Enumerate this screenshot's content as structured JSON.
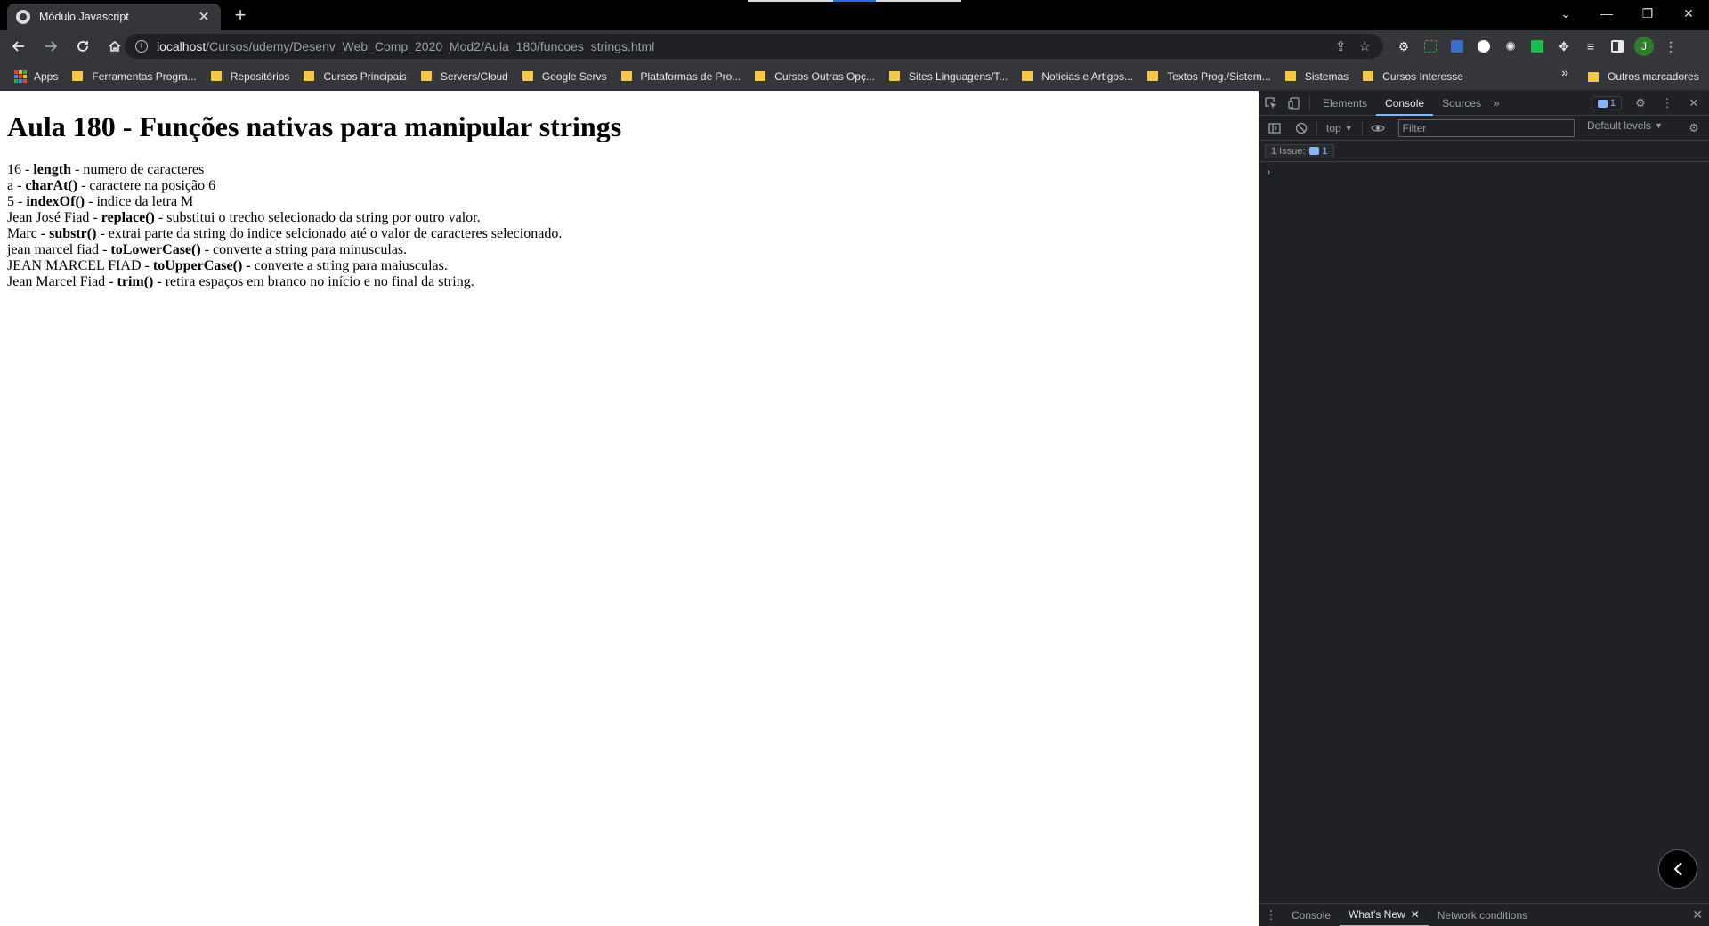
{
  "tab": {
    "title": "Módulo Javascript",
    "close": "✕",
    "new": "+"
  },
  "window_controls": {
    "dropdown": "⌄",
    "minimize": "—",
    "restore": "❐",
    "close": "✕"
  },
  "omnibox": {
    "host": "localhost",
    "path": "/Cursos/udemy/Desenv_Web_Comp_2020_Mod2/Aula_180/funcoes_strings.html"
  },
  "profile": {
    "initial": "J"
  },
  "bookmarks": {
    "apps": "Apps",
    "items": [
      "Ferramentas Progra...",
      "Repositórios",
      "Cursos Principais",
      "Servers/Cloud",
      "Google Servs",
      "Plataformas de Pro...",
      "Cursos Outras Opç...",
      "Sites Linguagens/T...",
      "Noticias e Artigos...",
      "Textos Prog./Sistem...",
      "Sistemas",
      "Cursos Interesse"
    ],
    "more": "»",
    "other": "Outros marcadores"
  },
  "page": {
    "heading": "Aula 180 - Funções nativas para manipular strings",
    "lines": [
      {
        "value": "16",
        "method": "length",
        "desc": "numero de caracteres"
      },
      {
        "value": "a",
        "method": "charAt()",
        "desc": "caractere na posição 6"
      },
      {
        "value": "5",
        "method": "indexOf()",
        "desc": "indice da letra M"
      },
      {
        "value": "Jean José Fiad",
        "method": "replace()",
        "desc": "substitui o trecho selecionado da string por outro valor."
      },
      {
        "value": "Marc",
        "method": "substr()",
        "desc": "extrai parte da string do indice selcionado até o valor de caracteres selecionado."
      },
      {
        "value": "jean marcel fiad",
        "method": "toLowerCase()",
        "desc": "converte a string para minusculas."
      },
      {
        "value": "JEAN MARCEL FIAD",
        "method": "toUpperCase()",
        "desc": "converte a string para maiusculas."
      },
      {
        "value": "Jean Marcel Fiad",
        "method": "trim()",
        "desc": "retira espaços em branco no início e no final da string."
      }
    ]
  },
  "devtools": {
    "tabs": [
      "Elements",
      "Console",
      "Sources"
    ],
    "active_tab": "Console",
    "more_tabs": "»",
    "issues_count": "1",
    "context": "top",
    "filter_placeholder": "Filter",
    "levels": "Default levels",
    "issues_label": "1 Issue:",
    "issues_badge_count": "1",
    "prompt": "›",
    "drawer_tabs": [
      "Console",
      "What's New",
      "Network conditions"
    ],
    "drawer_active": "What's New"
  }
}
